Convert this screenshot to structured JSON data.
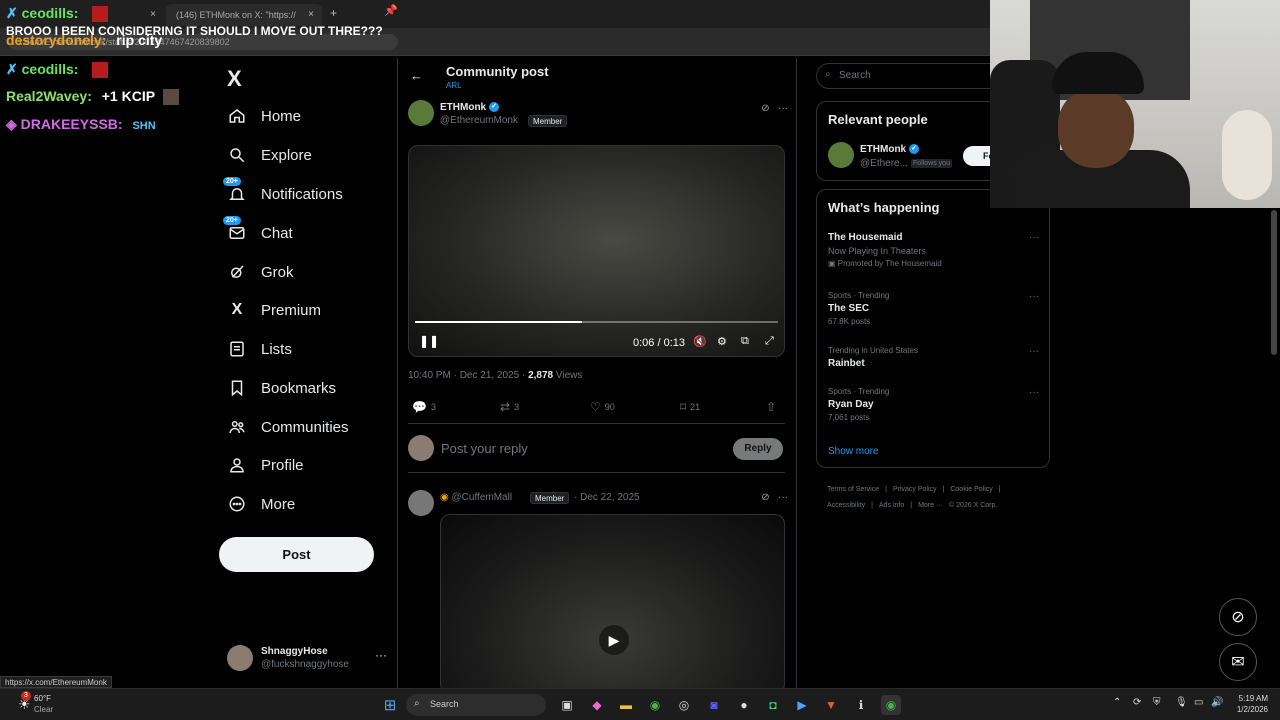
{
  "browser": {
    "tab1_title": "",
    "tab2_title": "(146) ETHMonk on X: \"https://",
    "new_tab": "+",
    "close": "×",
    "url": "x.com/EthereumMonk/status/2002947467420839802"
  },
  "chat": {
    "messages": [
      {
        "user": "ceodills:",
        "text": "",
        "user_color": "#69e06b"
      },
      {
        "user": "",
        "text": "BROOO I BEEN CONSIDERING IT SHOULD I MOVE OUT THRE???",
        "user_color": "#ffffff"
      },
      {
        "user": "destorydonely:",
        "text": "rip city",
        "user_color": "#f0a020"
      },
      {
        "user": "ceodills:",
        "text": "",
        "user_color": "#69e06b"
      },
      {
        "user": "Real2Wavey:",
        "text": "+1 KCIP",
        "user_color": "#8fe06b"
      },
      {
        "user": "DRAKEEYSSB:",
        "text": "SHN",
        "user_color": "#d16be0"
      }
    ]
  },
  "nav": {
    "logo": "X",
    "items": [
      {
        "label": "Home",
        "icon": "home-icon",
        "badge": ""
      },
      {
        "label": "Explore",
        "icon": "search-icon",
        "badge": ""
      },
      {
        "label": "Notifications",
        "icon": "bell-icon",
        "badge": "20+"
      },
      {
        "label": "Chat",
        "icon": "mail-icon",
        "badge": "20+"
      },
      {
        "label": "Grok",
        "icon": "grok-icon",
        "badge": ""
      },
      {
        "label": "Premium",
        "icon": "x-icon",
        "badge": ""
      },
      {
        "label": "Lists",
        "icon": "list-icon",
        "badge": ""
      },
      {
        "label": "Bookmarks",
        "icon": "bookmark-icon",
        "badge": ""
      },
      {
        "label": "Communities",
        "icon": "people-icon",
        "badge": ""
      },
      {
        "label": "Profile",
        "icon": "person-icon",
        "badge": ""
      },
      {
        "label": "More",
        "icon": "more-circle-icon",
        "badge": ""
      }
    ],
    "post_button": "Post",
    "account": {
      "name": "ShnaggyHose",
      "handle": "@fuckshnaggyhose",
      "menu": "···"
    }
  },
  "main": {
    "back": "←",
    "title": "Community post",
    "subtitle": "ARL",
    "post": {
      "name": "ETHMonk",
      "handle": "@EthereumMonk",
      "member": "Member",
      "video_time": "0:06 / 0:13",
      "video_progress": 0.46,
      "timestamp": "10:40 PM · Dec 21, 2025 · ",
      "views_count": "2,878",
      "views_label": " Views",
      "replies": "3",
      "reposts": "3",
      "likes": "90",
      "bookmarks": "21"
    },
    "reply_placeholder": "Post your reply",
    "reply_button": "Reply",
    "post2": {
      "handle": "@CuffemMall",
      "member": "Member",
      "date": "· Dec 22, 2025"
    }
  },
  "right": {
    "search_placeholder": "Search",
    "relevant_title": "Relevant people",
    "relevant": {
      "name": "ETHMonk",
      "handle": "@Ethere...",
      "follows_you": "Follows you",
      "follow_button": "Foll"
    },
    "happening_title": "What’s happening",
    "trends": [
      {
        "context": "",
        "title": "The Housemaid",
        "sub": "Now Playing In Theaters",
        "promo": "Promoted by The Housemaid"
      },
      {
        "context": "Sports · Trending",
        "title": "The SEC",
        "count": "67.8K posts"
      },
      {
        "context": "Trending in United States",
        "title": "Rainbet",
        "count": ""
      },
      {
        "context": "Sports · Trending",
        "title": "Ryan Day",
        "count": "7,061 posts"
      }
    ],
    "show_more": "Show more",
    "footer": [
      "Terms of Service",
      "|",
      "Privacy Policy",
      "|",
      "Cookie Policy",
      "|",
      "Accessibility",
      "|",
      "Ads info",
      "|",
      "More ···",
      "© 2026 X Corp."
    ]
  },
  "status_url": "https://x.com/EthereumMonk",
  "taskbar": {
    "weather_temp": "60°F",
    "weather_cond": "Clear",
    "weather_badge": "3",
    "search": "Search",
    "time": "5:19 AM",
    "date": "1/2/2026"
  }
}
